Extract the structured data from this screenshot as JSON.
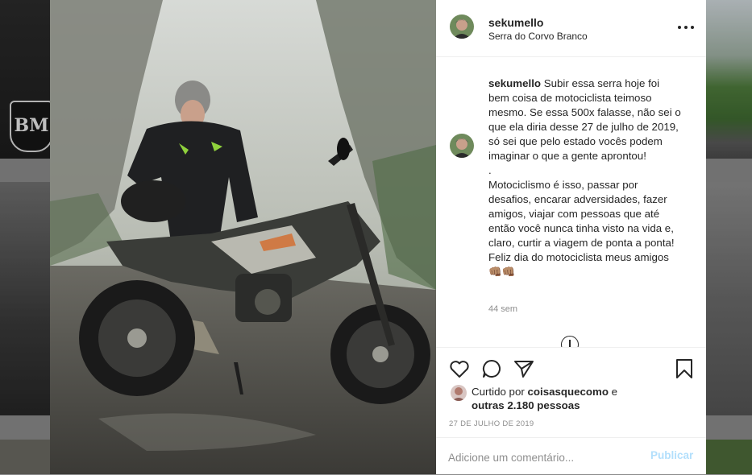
{
  "background": {
    "left_emblem_text": "BM"
  },
  "post": {
    "username": "sekumello",
    "location": "Serra do Corvo Branco",
    "caption": "Subir essa serra hoje foi bem coisa de motociclista teimoso mesmo. Se essa 500x falasse, não sei o que ela diria desse 27 de julho de 2019, só sei que pelo estado vocês podem imaginar o que a gente aprontou!\n.\nMotociclismo é isso, passar por desafios, encarar adversidades, fazer amigos, viajar com pessoas que até então você nunca tinha visto na vida e, claro, curtir a viagem de ponta a ponta! Feliz dia do motociclista meus amigos 👊🏽👊🏽",
    "time_ago": "44 sem",
    "likes": {
      "prefix": "Curtido por ",
      "user": "coisasquecomo",
      "suffix": " e",
      "others": "outras 2.180 pessoas"
    },
    "date": "27 DE JULHO DE 2019",
    "comment_placeholder": "Adicione um comentário...",
    "publish_label": "Publicar"
  },
  "icons": {
    "more": "more-options-icon",
    "like": "heart-icon",
    "comment": "comment-icon",
    "share": "paper-plane-icon",
    "save": "bookmark-icon",
    "load_more": "plus-circle-icon"
  },
  "colors": {
    "text": "#262626",
    "secondary": "#8e8e8e",
    "publish_disabled": "#b2dffc",
    "border": "#efefef"
  }
}
